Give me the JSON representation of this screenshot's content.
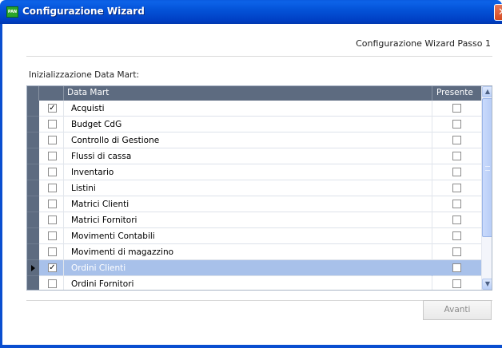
{
  "window": {
    "title": "Configurazione Wizard",
    "app_icon_text": "PAN",
    "close_glyph": "✕"
  },
  "header": {
    "step_label": "Configurazione Wizard Passo 1"
  },
  "section": {
    "label": "Inizializzazione Data Mart:"
  },
  "grid": {
    "columns": {
      "name": "Data Mart",
      "present": "Presente"
    },
    "rows": [
      {
        "name": "Acquisti",
        "selected": true,
        "present": false,
        "current": false
      },
      {
        "name": "Budget CdG",
        "selected": false,
        "present": false,
        "current": false
      },
      {
        "name": "Controllo di Gestione",
        "selected": false,
        "present": false,
        "current": false
      },
      {
        "name": "Flussi di cassa",
        "selected": false,
        "present": false,
        "current": false
      },
      {
        "name": "Inventario",
        "selected": false,
        "present": false,
        "current": false
      },
      {
        "name": "Listini",
        "selected": false,
        "present": false,
        "current": false
      },
      {
        "name": "Matrici Clienti",
        "selected": false,
        "present": false,
        "current": false
      },
      {
        "name": "Matrici Fornitori",
        "selected": false,
        "present": false,
        "current": false
      },
      {
        "name": "Movimenti Contabili",
        "selected": false,
        "present": false,
        "current": false
      },
      {
        "name": "Movimenti di magazzino",
        "selected": false,
        "present": false,
        "current": false
      },
      {
        "name": "Ordini Clienti",
        "selected": true,
        "present": false,
        "current": true
      },
      {
        "name": "Ordini Fornitori",
        "selected": false,
        "present": false,
        "current": false
      }
    ],
    "scroll_up_glyph": "▲",
    "scroll_down_glyph": "▼"
  },
  "footer": {
    "next_label": "Avanti"
  },
  "colors": {
    "titlebar": "#0453d8",
    "grid_header": "#5d6b80",
    "selected_row": "#a8c1ea"
  }
}
